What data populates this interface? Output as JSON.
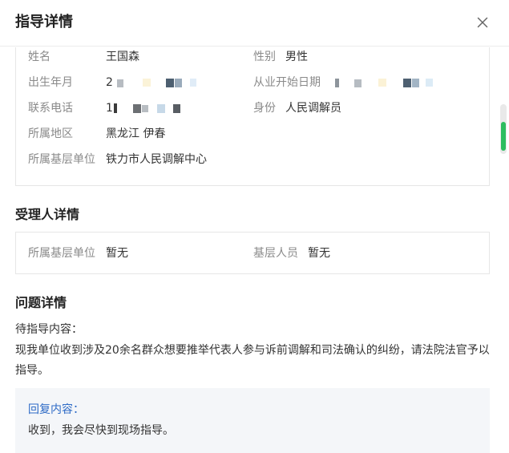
{
  "dialog": {
    "title": "指导详情",
    "close_icon": "close-icon"
  },
  "person": {
    "name_label": "姓名",
    "name_value": "王国森",
    "gender_label": "性别",
    "gender_value": "男性",
    "birth_label": "出生年月",
    "birth_value_visible": "2",
    "career_start_label": "从业开始日期",
    "phone_label": "联系电话",
    "phone_value_visible": "1",
    "identity_label": "身份",
    "identity_value": "人民调解员",
    "region_label": "所属地区",
    "region_value": "黑龙江 伊春",
    "unit_label": "所属基层单位",
    "unit_value": "铁力市人民调解中心"
  },
  "handler": {
    "section_title": "受理人详情",
    "unit_label": "所属基层单位",
    "unit_value": "暂无",
    "staff_label": "基层人员",
    "staff_value": "暂无"
  },
  "problem": {
    "section_title": "问题详情",
    "content_label": "待指导内容：",
    "content_text": "现我单位收到涉及20余名群众想要推举代表人参与诉前调解和司法确认的纠纷，请法院法官予以指导。",
    "reply_label": "回复内容：",
    "reply_text": "收到，我会尽快到现场指导。"
  },
  "colors": {
    "reply_label": "#2e6bc6",
    "reply_bg": "#f4f6f9",
    "scroll_thumb": "#2dbd5f"
  }
}
